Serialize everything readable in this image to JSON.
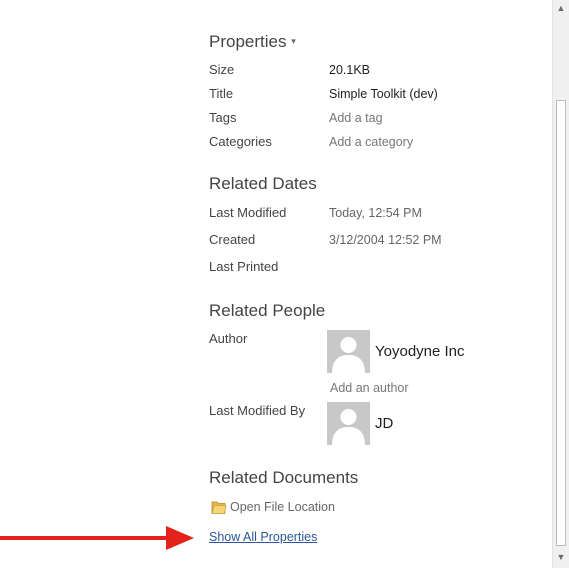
{
  "properties": {
    "title": "Properties",
    "rows": [
      {
        "label": "Size",
        "value": "20.1KB"
      },
      {
        "label": "Title",
        "value": "Simple Toolkit (dev)"
      },
      {
        "label": "Tags",
        "value": "Add a tag"
      },
      {
        "label": "Categories",
        "value": "Add a category"
      }
    ]
  },
  "related_dates": {
    "title": "Related Dates",
    "rows": [
      {
        "label": "Last Modified",
        "value": "Today, 12:54 PM"
      },
      {
        "label": "Created",
        "value": "3/12/2004 12:52 PM"
      },
      {
        "label": "Last Printed",
        "value": ""
      }
    ]
  },
  "related_people": {
    "title": "Related People",
    "author_label": "Author",
    "author_name": "Yoyodyne Inc",
    "add_author": "Add an author",
    "last_modified_by_label": "Last Modified By",
    "last_modified_by_name": "JD"
  },
  "related_documents": {
    "title": "Related Documents",
    "open_file_location": "Open File Location"
  },
  "show_all_properties": "Show All Properties",
  "colors": {
    "arrow": "#e32219",
    "link": "#2b579a"
  }
}
